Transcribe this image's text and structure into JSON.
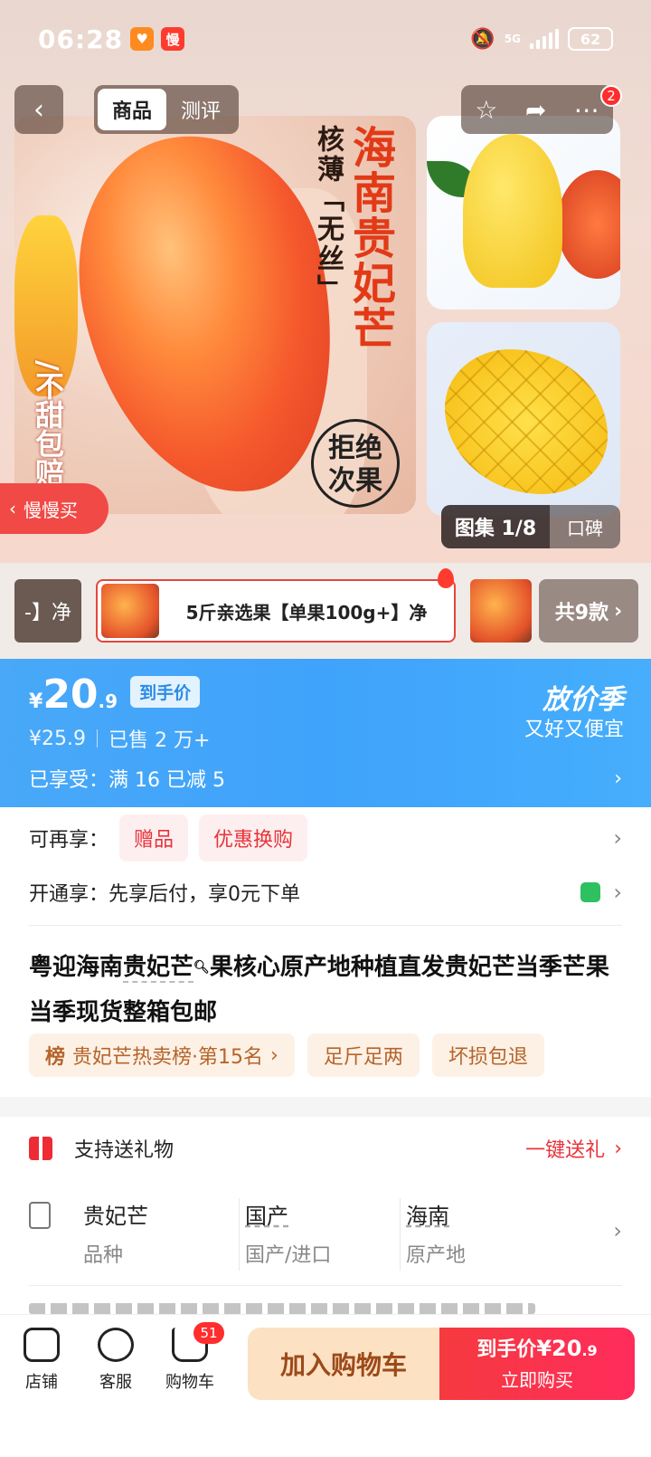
{
  "status": {
    "time": "06:28",
    "app_icon_a": "♥",
    "app_icon_b": "慢",
    "network": "5G",
    "battery": "62"
  },
  "header": {
    "tabs": [
      {
        "label": "商品"
      },
      {
        "label": "测评"
      }
    ],
    "badge_count": "2",
    "icons": [
      "back-icon",
      "star-icon",
      "share-icon",
      "more-icon"
    ]
  },
  "gallery": {
    "main_title": "海南贵妃芒",
    "main_sub": "核薄「无丝」",
    "side_text": "/不甜包赔",
    "seal_line1": "拒绝",
    "seal_line2": "次果",
    "counter": "图集 1/8",
    "reviews_tab": "口碑",
    "slow_buy": "慢慢买"
  },
  "sku": {
    "prev_fragment": "-】净",
    "selected": "5斤亲选果【单果100g+】净",
    "total": "共9款"
  },
  "price": {
    "currency": "¥",
    "integer": "20",
    "decimal": ".9",
    "tag": "到手价",
    "original": "¥25.9",
    "sold": "已售 2 万+",
    "promo_title": "放价季",
    "promo_sub": "又好又便宜",
    "enjoyed": "已享受：满 16 已减 5"
  },
  "offers": {
    "more_label": "可再享：",
    "pills": [
      "赠品",
      "优惠换购"
    ],
    "open_label": "开通享：",
    "open_text": "先享后付，享0元下单"
  },
  "product": {
    "title_part1": "粤迎海南",
    "title_link": "贵妃芒",
    "title_part2": "果核心原产地种植直发贵妃芒当季芒果当季现货整箱包邮",
    "rank_icon": "榜",
    "rank_text": "贵妃芒热卖榜·第15名",
    "tags": [
      "足斤足两",
      "坏损包退"
    ]
  },
  "gift": {
    "label": "支持送礼物",
    "link": "一键送礼"
  },
  "attributes": [
    {
      "value": "贵妃芒",
      "key": "品种"
    },
    {
      "value": "国产",
      "key": "国产/进口"
    },
    {
      "value": "海南",
      "key": "原产地"
    }
  ],
  "bottom_bar": {
    "shop": "店铺",
    "service": "客服",
    "cart": "购物车",
    "cart_count": "51",
    "add_cart": "加入购物车",
    "buy_price_label": "到手价",
    "buy_price": "¥20",
    "buy_price_dec": ".9",
    "buy_now": "立即购买"
  },
  "colors": {
    "price_band": "#45a8fa",
    "accent_red": "#f53a3f",
    "tag_orange": "#b6642b"
  }
}
